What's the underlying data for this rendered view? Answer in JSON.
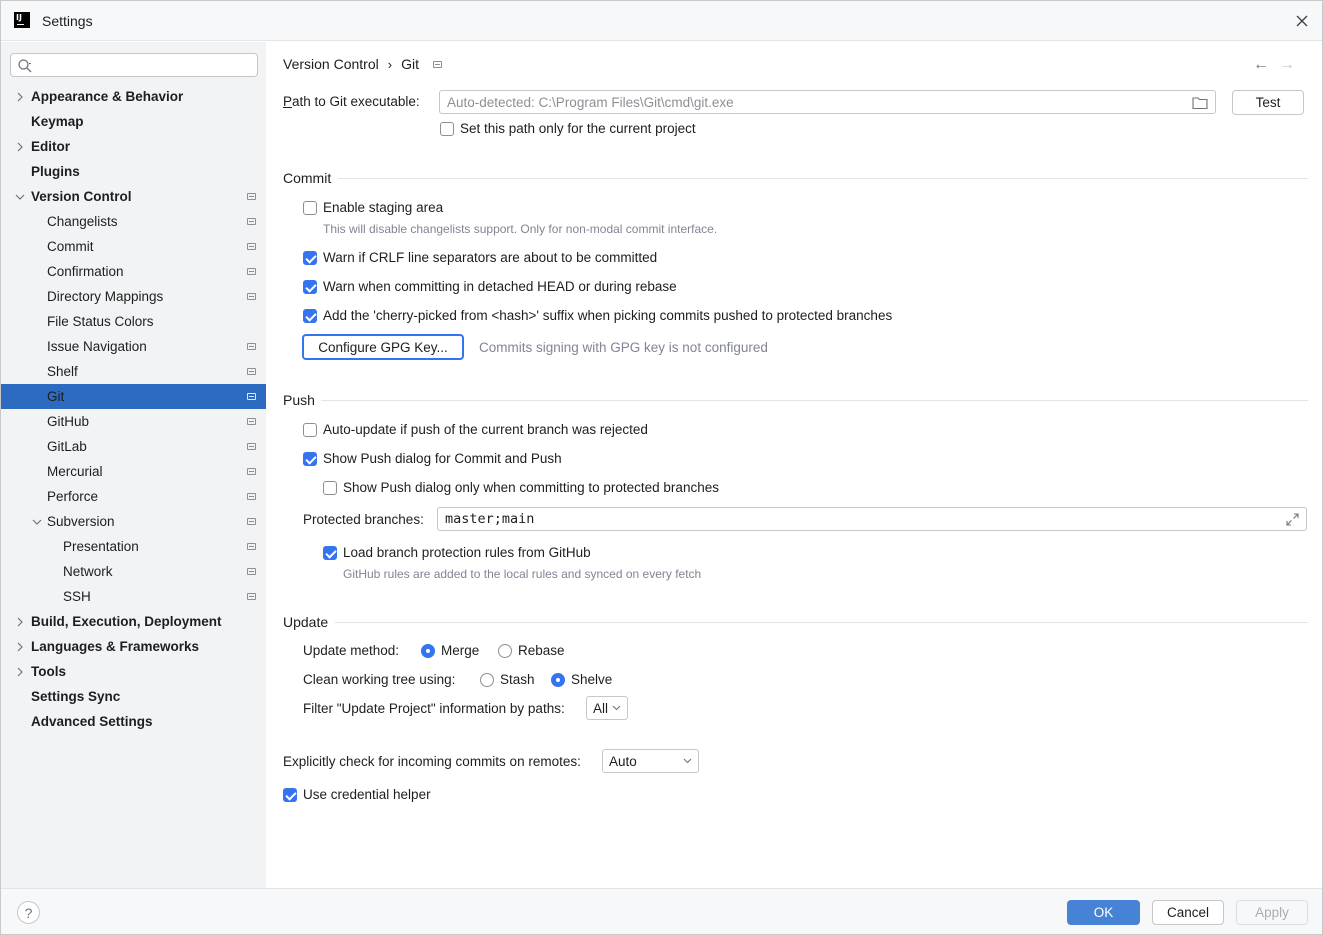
{
  "window": {
    "title": "Settings",
    "logo_text": "IJ"
  },
  "search": {
    "placeholder": "",
    "value": ""
  },
  "sidebar": {
    "items": [
      {
        "label": "Appearance & Behavior"
      },
      {
        "label": "Keymap"
      },
      {
        "label": "Editor"
      },
      {
        "label": "Plugins"
      },
      {
        "label": "Version Control"
      },
      {
        "label": "Changelists"
      },
      {
        "label": "Commit"
      },
      {
        "label": "Confirmation"
      },
      {
        "label": "Directory Mappings"
      },
      {
        "label": "File Status Colors"
      },
      {
        "label": "Issue Navigation"
      },
      {
        "label": "Shelf"
      },
      {
        "label": "Git"
      },
      {
        "label": "GitHub"
      },
      {
        "label": "GitLab"
      },
      {
        "label": "Mercurial"
      },
      {
        "label": "Perforce"
      },
      {
        "label": "Subversion"
      },
      {
        "label": "Presentation"
      },
      {
        "label": "Network"
      },
      {
        "label": "SSH"
      },
      {
        "label": "Build, Execution, Deployment"
      },
      {
        "label": "Languages & Frameworks"
      },
      {
        "label": "Tools"
      },
      {
        "label": "Settings Sync"
      },
      {
        "label": "Advanced Settings"
      }
    ]
  },
  "breadcrumb": {
    "parent": "Version Control",
    "separator": "›",
    "current": "Git"
  },
  "nav": {
    "back": "←",
    "forward": "→"
  },
  "git_path": {
    "label_prefix": "P",
    "label_rest": "ath to Git executable:",
    "placeholder": "Auto-detected: C:\\Program Files\\Git\\cmd\\git.exe",
    "value": "",
    "test_button": "Test",
    "project_only_label": "Set this path only for the current project",
    "project_only_checked": false
  },
  "commit": {
    "title": "Commit",
    "staging_label": "Enable staging area",
    "staging_checked": false,
    "staging_hint": "This will disable changelists support. Only for non-modal commit interface.",
    "crlf_label": "Warn if CRLF line separators are about to be committed",
    "crlf_checked": true,
    "detached_label": "Warn when committing in detached HEAD or during rebase",
    "detached_checked": true,
    "cherry_label": "Add the 'cherry-picked from <hash>' suffix when picking commits pushed to protected branches",
    "cherry_checked": true,
    "gpg_button": "Configure GPG Key...",
    "gpg_status": "Commits signing with GPG key is not configured"
  },
  "push": {
    "title": "Push",
    "autoupdate_label": "Auto-update if push of the current branch was rejected",
    "autoupdate_checked": false,
    "show_dialog_label": "Show Push dialog for Commit and Push",
    "show_dialog_checked": true,
    "protected_only_label": "Show Push dialog only when committing to protected branches",
    "protected_only_checked": false,
    "protected_label": "Protected branches:",
    "protected_value": "master;main",
    "github_rules_label": "Load branch protection rules from GitHub",
    "github_rules_checked": true,
    "github_rules_hint": "GitHub rules are added to the local rules and synced on every fetch"
  },
  "update": {
    "title": "Update",
    "method_label": "Update method:",
    "merge_label": "Merge",
    "rebase_label": "Rebase",
    "method_selected": "Merge",
    "clean_label": "Clean working tree using:",
    "stash_label": "Stash",
    "shelve_label": "Shelve",
    "clean_selected": "Shelve",
    "filter_label": "Filter \"Update Project\" information by paths:",
    "filter_value": "All"
  },
  "incoming": {
    "label": "Explicitly check for incoming commits on remotes:",
    "value": "Auto"
  },
  "credential": {
    "label": "Use credential helper",
    "checked": true
  },
  "buttons": {
    "help": "?",
    "ok": "OK",
    "cancel": "Cancel",
    "apply": "Apply"
  },
  "colors": {
    "accent": "#3574f0",
    "selection": "#2d6bc1",
    "sidebar_bg": "#f2f3f5"
  }
}
